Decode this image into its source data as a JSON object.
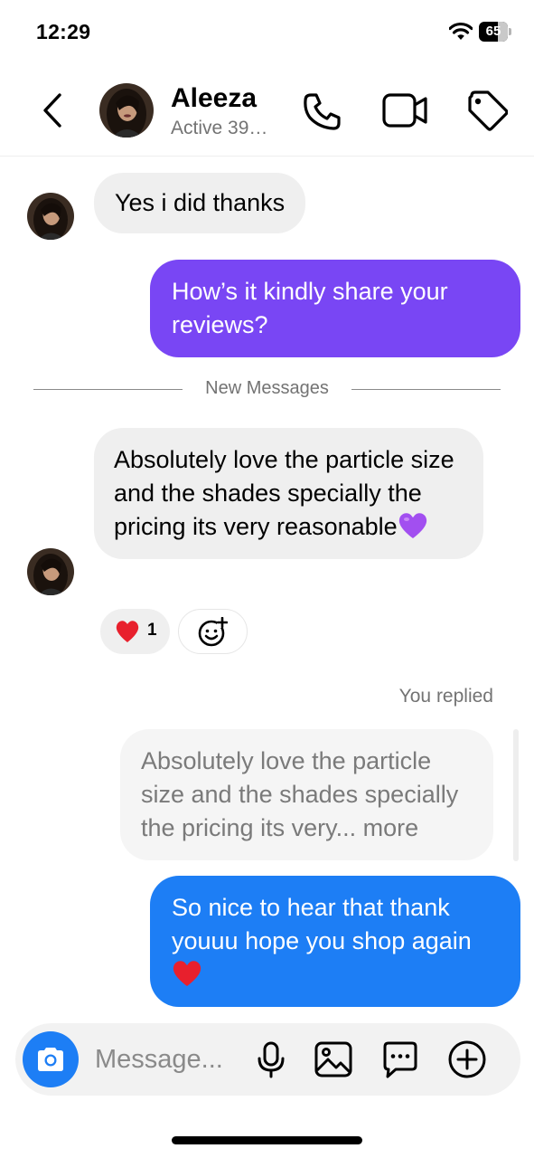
{
  "status_bar": {
    "time": "12:29",
    "battery": "65",
    "battery_level": 0.65
  },
  "header": {
    "name": "Aleeza",
    "status": "Active 39…",
    "icons": [
      "back-icon",
      "phone-icon",
      "video-camera-icon",
      "tag-icon"
    ]
  },
  "messages": [
    {
      "from": "them",
      "text": "Yes i did thanks"
    },
    {
      "from": "me",
      "text": "How’s it kindly share your reviews?"
    },
    {
      "from": "them",
      "text": "Absolutely love the particle size and the shades specially the pricing its very reasonable"
    },
    {
      "from": "me",
      "text": "So nice to hear that thank youuu hope you shop again"
    }
  ],
  "divider": {
    "label": "New Messages"
  },
  "reactions": {
    "count": "1",
    "emoji": "red-heart",
    "add_icon": "add-reaction-icon"
  },
  "reply": {
    "label": "You replied",
    "quoted_text": "Absolutely love the particle size and the shades specially the pricing its very...",
    "more_label": "more"
  },
  "composer": {
    "placeholder": "Message...",
    "icons": [
      "camera-icon",
      "microphone-icon",
      "gallery-icon",
      "sticker-chat-icon",
      "plus-icon"
    ]
  },
  "colors": {
    "purple_bubble": "#7946f4",
    "blue_bubble": "#1d7ef5",
    "incoming_bubble": "#efefef"
  }
}
